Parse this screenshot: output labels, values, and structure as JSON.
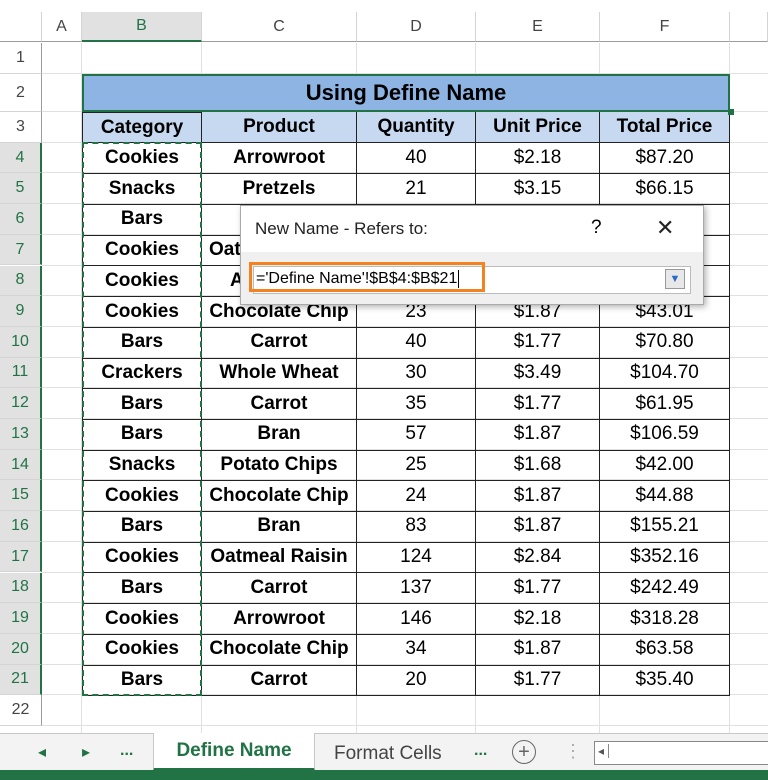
{
  "columns": [
    "A",
    "B",
    "C",
    "D",
    "E",
    "F"
  ],
  "rows": [
    "1",
    "2",
    "3",
    "4",
    "5",
    "6",
    "7",
    "8",
    "9",
    "10",
    "11",
    "12",
    "13",
    "14",
    "15",
    "16",
    "17",
    "18",
    "19",
    "20",
    "21",
    "22"
  ],
  "title": "Using Define Name",
  "headers": [
    "Category",
    "Product",
    "Quantity",
    "Unit Price",
    "Total Price"
  ],
  "data": [
    [
      "Cookies",
      "Arrowroot",
      "40",
      "$2.18",
      "$87.20"
    ],
    [
      "Snacks",
      "Pretzels",
      "21",
      "$3.15",
      "$66.15"
    ],
    [
      "Bars",
      "",
      "",
      "",
      ""
    ],
    [
      "Cookies",
      "Oat",
      "",
      "",
      ""
    ],
    [
      "Cookies",
      "A",
      "",
      "",
      ""
    ],
    [
      "Cookies",
      "Chocolate Chip",
      "23",
      "$1.87",
      "$43.01"
    ],
    [
      "Bars",
      "Carrot",
      "40",
      "$1.77",
      "$70.80"
    ],
    [
      "Crackers",
      "Whole Wheat",
      "30",
      "$3.49",
      "$104.70"
    ],
    [
      "Bars",
      "Carrot",
      "35",
      "$1.77",
      "$61.95"
    ],
    [
      "Bars",
      "Bran",
      "57",
      "$1.87",
      "$106.59"
    ],
    [
      "Snacks",
      "Potato Chips",
      "25",
      "$1.68",
      "$42.00"
    ],
    [
      "Cookies",
      "Chocolate Chip",
      "24",
      "$1.87",
      "$44.88"
    ],
    [
      "Bars",
      "Bran",
      "83",
      "$1.87",
      "$155.21"
    ],
    [
      "Cookies",
      "Oatmeal Raisin",
      "124",
      "$2.84",
      "$352.16"
    ],
    [
      "Bars",
      "Carrot",
      "137",
      "$1.77",
      "$242.49"
    ],
    [
      "Cookies",
      "Arrowroot",
      "146",
      "$2.18",
      "$318.28"
    ],
    [
      "Cookies",
      "Chocolate Chip",
      "34",
      "$1.87",
      "$63.58"
    ],
    [
      "Bars",
      "Carrot",
      "20",
      "$1.77",
      "$35.40"
    ]
  ],
  "dialog": {
    "title": "New Name - Refers to:",
    "help": "?",
    "close": "✕",
    "value": "='Define Name'!$B$4:$B$21"
  },
  "tabs": {
    "prev": "◂",
    "next": "▸",
    "more_left": "...",
    "active": "Define Name",
    "other": "Format Cells",
    "more_right": "...",
    "add": "+",
    "menu": "⋮"
  },
  "colors": {
    "accent": "#217346",
    "header_fill": "#c6d9f1",
    "title_fill": "#8db4e2",
    "highlight": "#f58220"
  }
}
